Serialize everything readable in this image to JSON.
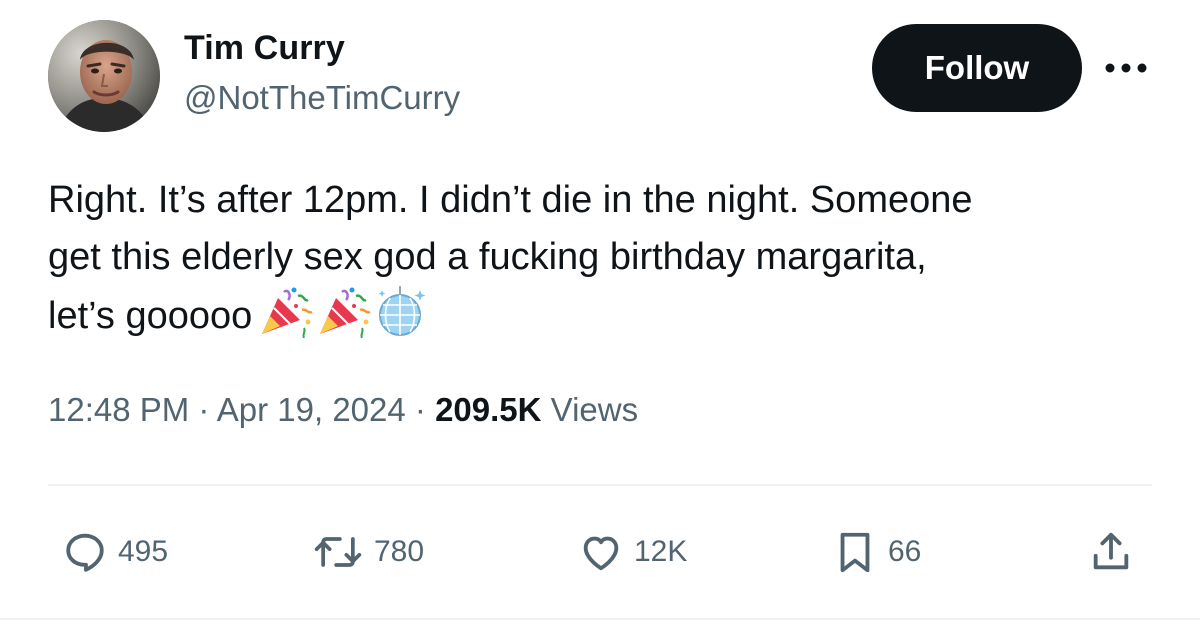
{
  "author": {
    "name": "Tim Curry",
    "handle": "@NotTheTimCurry",
    "avatar_alt": "profile photo"
  },
  "follow_label": "Follow",
  "more_icon": "more-options-icon",
  "tweet": {
    "lines": [
      "Right. It’s after 12pm. I didn’t die in the night. Someone",
      "get this elderly sex god a fucking birthday margarita,",
      "let’s gooooo"
    ],
    "emojis": [
      "party-popper-emoji",
      "party-popper-emoji",
      "mirror-ball-emoji"
    ]
  },
  "meta": {
    "time": "12:48 PM",
    "separator": " · ",
    "date": "Apr 19, 2024",
    "views_count": "209.5K",
    "views_label": "Views"
  },
  "actions": {
    "replies": "495",
    "reposts": "780",
    "likes": "12K",
    "bookmarks": "66"
  },
  "colors": {
    "text": "#0f1419",
    "secondary": "#536471",
    "button_bg": "#0f1419",
    "button_text": "#ffffff",
    "divider": "#eff3f4"
  }
}
